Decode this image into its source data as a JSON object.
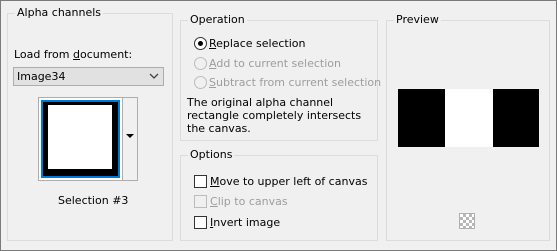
{
  "alpha_channels": {
    "title": "Alpha channels",
    "load_from_label": "Load from document:",
    "load_from_mnemonic": "d",
    "document_value": "Image34",
    "selection_name": "Selection #3"
  },
  "operation": {
    "title": "Operation",
    "options": [
      {
        "label": "Replace selection",
        "mnemonic": "R",
        "checked": true,
        "enabled": true
      },
      {
        "label": "Add to current selection",
        "mnemonic": "A",
        "checked": false,
        "enabled": false
      },
      {
        "label": "Subtract from current selection",
        "mnemonic": "S",
        "checked": false,
        "enabled": false
      }
    ],
    "description": "The original alpha channel rectangle completely intersects the canvas."
  },
  "options": {
    "title": "Options",
    "move_to_upper_left": {
      "label": "Move to upper left of canvas",
      "mnemonic": "M",
      "checked": false,
      "enabled": true
    },
    "clip_to_canvas": {
      "label": "Clip to canvas",
      "mnemonic": "C",
      "checked": false,
      "enabled": false
    },
    "invert_image": {
      "label": "Invert image",
      "mnemonic": "I",
      "checked": false,
      "enabled": true
    }
  },
  "preview": {
    "title": "Preview"
  },
  "colors": {
    "background": "#f0f0f0",
    "accent": "#0078d7",
    "disabled_text": "#9d9d9d"
  }
}
